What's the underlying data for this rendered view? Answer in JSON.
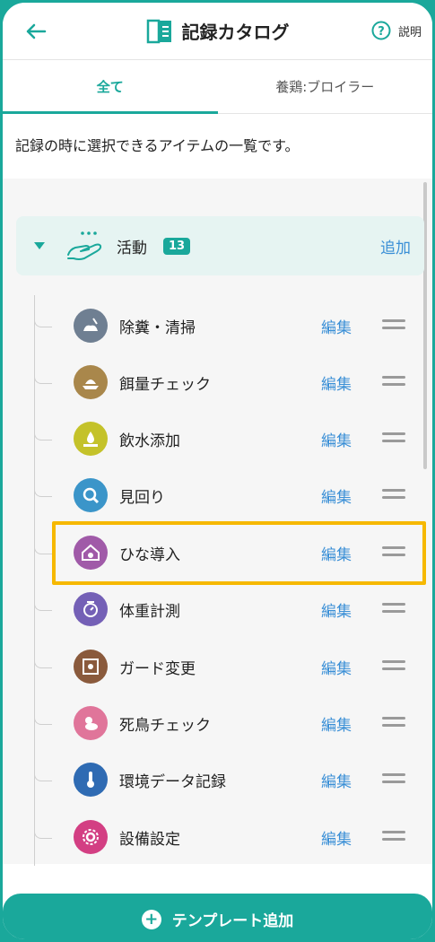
{
  "header": {
    "back_icon": "arrow-left-icon",
    "title_icon": "catalog-book-icon",
    "title": "記録カタログ",
    "help_icon": "question-circle-icon",
    "help_label": "説明"
  },
  "tabs": [
    {
      "label": "全て",
      "active": true
    },
    {
      "label": "養鶏:ブロイラー",
      "active": false
    }
  ],
  "description": "記録の時に選択できるアイテムの一覧です。",
  "category": {
    "label": "活動",
    "count": "13",
    "add_label": "追加",
    "icon": "hand-with-dots-icon"
  },
  "items": [
    {
      "label": "除糞・清掃",
      "edit": "編集",
      "icon": "cleaning-icon",
      "color": "#6f7f92"
    },
    {
      "label": "餌量チェック",
      "edit": "編集",
      "icon": "feed-icon",
      "color": "#a9874b"
    },
    {
      "label": "飲水添加",
      "edit": "編集",
      "icon": "water-icon",
      "color": "#c4c22a"
    },
    {
      "label": "見回り",
      "edit": "編集",
      "icon": "patrol-icon",
      "color": "#3b95c9"
    },
    {
      "label": "ひな導入",
      "edit": "編集",
      "icon": "chick-house-icon",
      "color": "#a05aa8"
    },
    {
      "label": "体重計測",
      "edit": "編集",
      "icon": "scale-icon",
      "color": "#7460b6"
    },
    {
      "label": "ガード変更",
      "edit": "編集",
      "icon": "guard-icon",
      "color": "#8a5a3c"
    },
    {
      "label": "死鳥チェック",
      "edit": "編集",
      "icon": "bird-icon",
      "color": "#e0759a"
    },
    {
      "label": "環境データ記録",
      "edit": "編集",
      "icon": "thermometer-icon",
      "color": "#2f6bb3"
    },
    {
      "label": "設備設定",
      "edit": "編集",
      "icon": "gear-icon",
      "color": "#d33f83"
    }
  ],
  "footer": {
    "icon": "plus-circle-icon",
    "label": "テンプレート追加"
  },
  "colors": {
    "accent": "#1aa89b",
    "link": "#3a8fd6",
    "highlight": "#f6b800"
  }
}
